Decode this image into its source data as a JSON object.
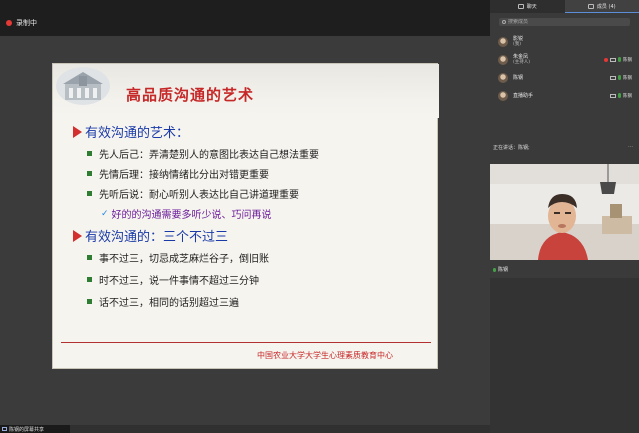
{
  "recording": {
    "label": "录制中",
    "dot_color": "#e53935"
  },
  "slide": {
    "title": "高品质沟通的艺术",
    "sections": [
      {
        "heading": "有效沟通的艺术：",
        "bullets": [
          "先人后己：弄清楚别人的意图比表达自己想法重要",
          "先情后理：接纳情绪比分出对错更重要",
          "先听后说：耐心听别人表达比自己讲道理重要"
        ],
        "sub_bullet": "好的的沟通需要多听少说、巧问再说"
      },
      {
        "heading": "有效沟通的：三个不过三",
        "bullets": [
          "事不过三，切忌成芝麻烂谷子，倒旧账",
          "时不过三，说一件事情不超过三分钟",
          "话不过三，相同的话别超过三遍"
        ]
      }
    ],
    "footer": "中国农业大学大学生心理素质教育中心",
    "colors": {
      "title": "#c62828",
      "heading": "#1a3aa8",
      "arrow": "#d32f2f",
      "bullet": "#2e7d32",
      "sub": "#6a1b9a"
    }
  },
  "share_status": {
    "label": "陈钢的屏幕共享"
  },
  "panel": {
    "tabs": [
      {
        "label": "聊天",
        "icon": "chat-icon",
        "active": false
      },
      {
        "label": "成员 (4)",
        "icon": "members-icon",
        "active": true
      }
    ],
    "search_placeholder": "搜索成员",
    "members": [
      {
        "name": "影锐",
        "role": "(我)",
        "mic_label": ""
      },
      {
        "name": "朱金凤",
        "role": "(主持人)",
        "mic_label": "陈钢"
      },
      {
        "name": "陈钢",
        "role": "",
        "mic_label": "陈钢"
      },
      {
        "name": "直播助手",
        "role": "",
        "mic_label": "陈钢"
      }
    ],
    "speaking": {
      "label": "正在讲话：陈钢;",
      "more": "…"
    },
    "video": {
      "name": "陈钢"
    }
  }
}
